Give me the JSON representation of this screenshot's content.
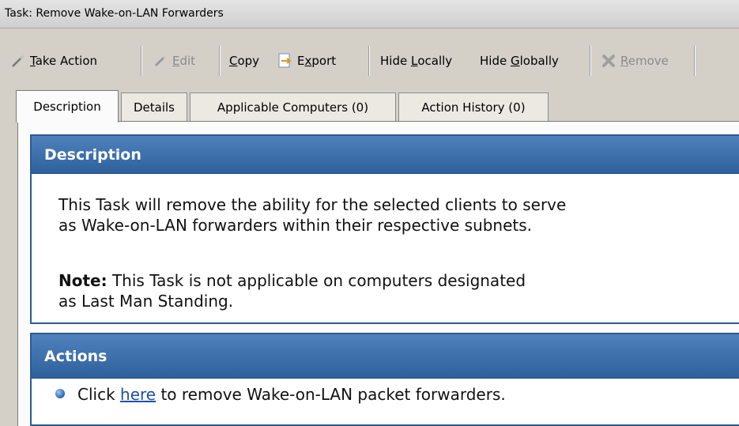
{
  "window": {
    "title": "Task: Remove Wake-on-LAN Forwarders"
  },
  "toolbar": {
    "take_action": {
      "prefix": "",
      "accel": "T",
      "rest": "ake Action",
      "icon": "wand-icon"
    },
    "edit": {
      "accel": "E",
      "rest": "dit",
      "icon": "pencil-icon",
      "disabled": true
    },
    "copy": {
      "accel": "C",
      "rest": "opy"
    },
    "export": {
      "prefix": "E",
      "accel": "x",
      "rest": "port",
      "icon": "export-icon"
    },
    "hide_locally": {
      "prefix": "Hide ",
      "accel": "L",
      "rest": "ocally"
    },
    "hide_globally": {
      "prefix": "Hide ",
      "accel": "G",
      "rest": "lobally"
    },
    "remove": {
      "accel": "R",
      "rest": "emove",
      "icon": "x-icon",
      "disabled": true
    }
  },
  "tabs": [
    {
      "label": "Description",
      "active": true
    },
    {
      "label": "Details",
      "active": false
    },
    {
      "label": "Applicable Computers (0)",
      "active": false
    },
    {
      "label": "Action History (0)",
      "active": false
    }
  ],
  "description": {
    "header": "Description",
    "line1": "This Task will remove the ability for the selected clients to serve",
    "line2": "as Wake-on-LAN forwarders within their respective subnets.",
    "note_label": "Note:",
    "note_line1": " This Task is not applicable on computers designated",
    "note_line2": "as Last Man Standing."
  },
  "actions": {
    "header": "Actions",
    "item_prefix": "Click ",
    "item_link": "here",
    "item_suffix": " to remove Wake-on-LAN packet forwarders."
  },
  "colors": {
    "header_blue": "#2e609c",
    "link": "#1f4fa8"
  }
}
